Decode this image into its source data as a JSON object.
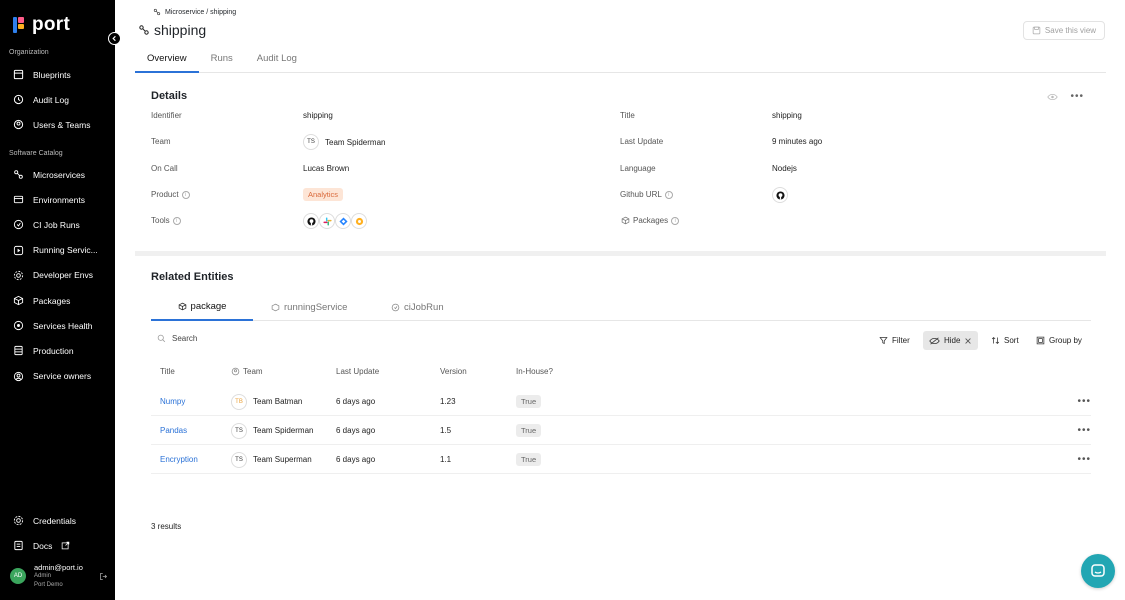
{
  "app": {
    "name": "port"
  },
  "sidebar": {
    "sections": [
      {
        "title": "Organization",
        "items": [
          {
            "label": "Blueprints",
            "icon": "blueprints-icon"
          },
          {
            "label": "Audit Log",
            "icon": "history-icon"
          },
          {
            "label": "Users & Teams",
            "icon": "users-icon"
          }
        ]
      },
      {
        "title": "Software Catalog",
        "items": [
          {
            "label": "Microservices",
            "icon": "microservice-icon"
          },
          {
            "label": "Environments",
            "icon": "environment-icon"
          },
          {
            "label": "CI Job Runs",
            "icon": "ci-job-icon"
          },
          {
            "label": "Running Servic...",
            "icon": "running-service-icon"
          },
          {
            "label": "Developer Envs",
            "icon": "dev-env-icon"
          },
          {
            "label": "Packages",
            "icon": "package-icon"
          },
          {
            "label": "Services Health",
            "icon": "health-icon"
          },
          {
            "label": "Production",
            "icon": "production-icon"
          },
          {
            "label": "Service owners",
            "icon": "owners-icon"
          }
        ]
      }
    ],
    "bottom": [
      {
        "label": "Credentials",
        "icon": "gear-icon"
      },
      {
        "label": "Docs",
        "icon": "docs-icon"
      }
    ],
    "user": {
      "initials": "AD",
      "email": "admin@port.io",
      "role": "Admin",
      "org": "Port Demo"
    }
  },
  "header": {
    "breadcrumb": "Microservice / shipping",
    "title": "shipping",
    "save_view": "Save this view",
    "tabs": [
      "Overview",
      "Runs",
      "Audit Log"
    ]
  },
  "details": {
    "heading": "Details",
    "left": [
      {
        "label": "Identifier",
        "value": "shipping"
      },
      {
        "label": "Team",
        "value": "Team Spiderman",
        "initials": "TS"
      },
      {
        "label": "On Call",
        "value": "Lucas Brown"
      },
      {
        "label": "Product",
        "value": "Analytics"
      },
      {
        "label": "Tools",
        "value": ""
      }
    ],
    "right": [
      {
        "label": "Title",
        "value": "shipping"
      },
      {
        "label": "Last Update",
        "value": "9 minutes ago"
      },
      {
        "label": "Language",
        "value": "Nodejs"
      },
      {
        "label": "Github URL",
        "value": ""
      },
      {
        "label": "Packages",
        "value": ""
      }
    ],
    "tools_icons": [
      "github-icon",
      "slack-icon",
      "jira-icon",
      "sentry-icon"
    ]
  },
  "related": {
    "heading": "Related Entities",
    "tabs": [
      "package",
      "runningService",
      "ciJobRun"
    ],
    "search_placeholder": "Search",
    "toolbar": {
      "filter": "Filter",
      "hide": "Hide",
      "sort": "Sort",
      "group_by": "Group by"
    },
    "columns": [
      "Title",
      "Team",
      "Last Update",
      "Version",
      "In-House?"
    ],
    "rows": [
      {
        "title": "Numpy",
        "team_initials": "TB",
        "team": "Team Batman",
        "last_update": "6 days ago",
        "version": "1.23",
        "in_house": "True"
      },
      {
        "title": "Pandas",
        "team_initials": "TS",
        "team": "Team Spiderman",
        "last_update": "6 days ago",
        "version": "1.5",
        "in_house": "True"
      },
      {
        "title": "Encryption",
        "team_initials": "TS",
        "team": "Team Superman",
        "last_update": "6 days ago",
        "version": "1.1",
        "in_house": "True"
      }
    ],
    "results": "3 results"
  },
  "colors": {
    "accent": "#2b72d7",
    "sidebar_bg": "#000000",
    "chat_bubble": "#22a6b3",
    "analytics_tag": "#fde5d6"
  }
}
